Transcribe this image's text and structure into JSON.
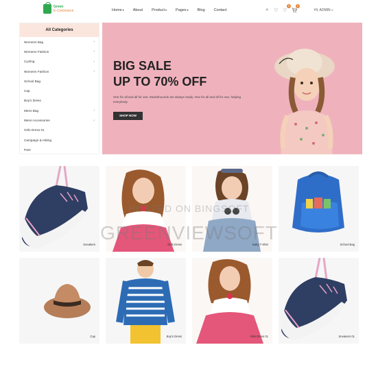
{
  "header": {
    "logo": {
      "line1": "Green",
      "line2": "E-Commerce"
    },
    "nav": [
      {
        "label": "Home",
        "caret": "▾"
      },
      {
        "label": "About",
        "caret": ""
      },
      {
        "label": "Product",
        "caret": "▾"
      },
      {
        "label": "Pages",
        "caret": "▾"
      },
      {
        "label": "Blog",
        "caret": ""
      },
      {
        "label": "Contact",
        "caret": ""
      }
    ],
    "icons": {
      "search": "⌕",
      "wishlist": "♡",
      "compare": "♡",
      "compare_badge": "0",
      "cart": "🛒",
      "cart_badge": "0"
    },
    "account": "HI, ADMIN ⌕"
  },
  "sidebar": {
    "title": "All Categories",
    "items": [
      {
        "label": "Womens Bag",
        "arrow": "›"
      },
      {
        "label": "Womens Fashion",
        "arrow": "›"
      },
      {
        "label": "Cycling",
        "arrow": "›"
      },
      {
        "label": "Womens Fashion",
        "arrow": "›"
      },
      {
        "label": "School Bag",
        "arrow": ""
      },
      {
        "label": "Cap",
        "arrow": ""
      },
      {
        "label": "Boy's Dress",
        "arrow": ""
      },
      {
        "label": "Mens Bag",
        "arrow": "›"
      },
      {
        "label": "Mens Accessories",
        "arrow": "›"
      },
      {
        "label": "Girls Dress 01",
        "arrow": ""
      },
      {
        "label": "Campaign & Hiking",
        "arrow": ""
      },
      {
        "label": "Pant",
        "arrow": ""
      }
    ]
  },
  "hero": {
    "title_line1": "BIG SALE",
    "title_line2": "UP TO 70% OFF",
    "subtitle": "One for all and all for one, Muskehounds are always ready. One for all and all for one, helping everybody.",
    "button": "SHOP NOW"
  },
  "products": [
    {
      "label": "Sneakers"
    },
    {
      "label": "Girls Dress"
    },
    {
      "label": "Baby T-Shirt"
    },
    {
      "label": "School Bag"
    },
    {
      "label": "Cap"
    },
    {
      "label": "Boy's Dress"
    },
    {
      "label": "Girls Dress 01"
    },
    {
      "label": "Sneakers 01"
    }
  ],
  "watermark": {
    "line1": "POSTED ON BINGSOFT",
    "line2": "GREENVIEWSOFT"
  },
  "colors": {
    "accent": "#2fa84f",
    "hero_bg": "#efb2bd",
    "sidebar_header": "#fbe6de",
    "badge": "#e8843a"
  }
}
